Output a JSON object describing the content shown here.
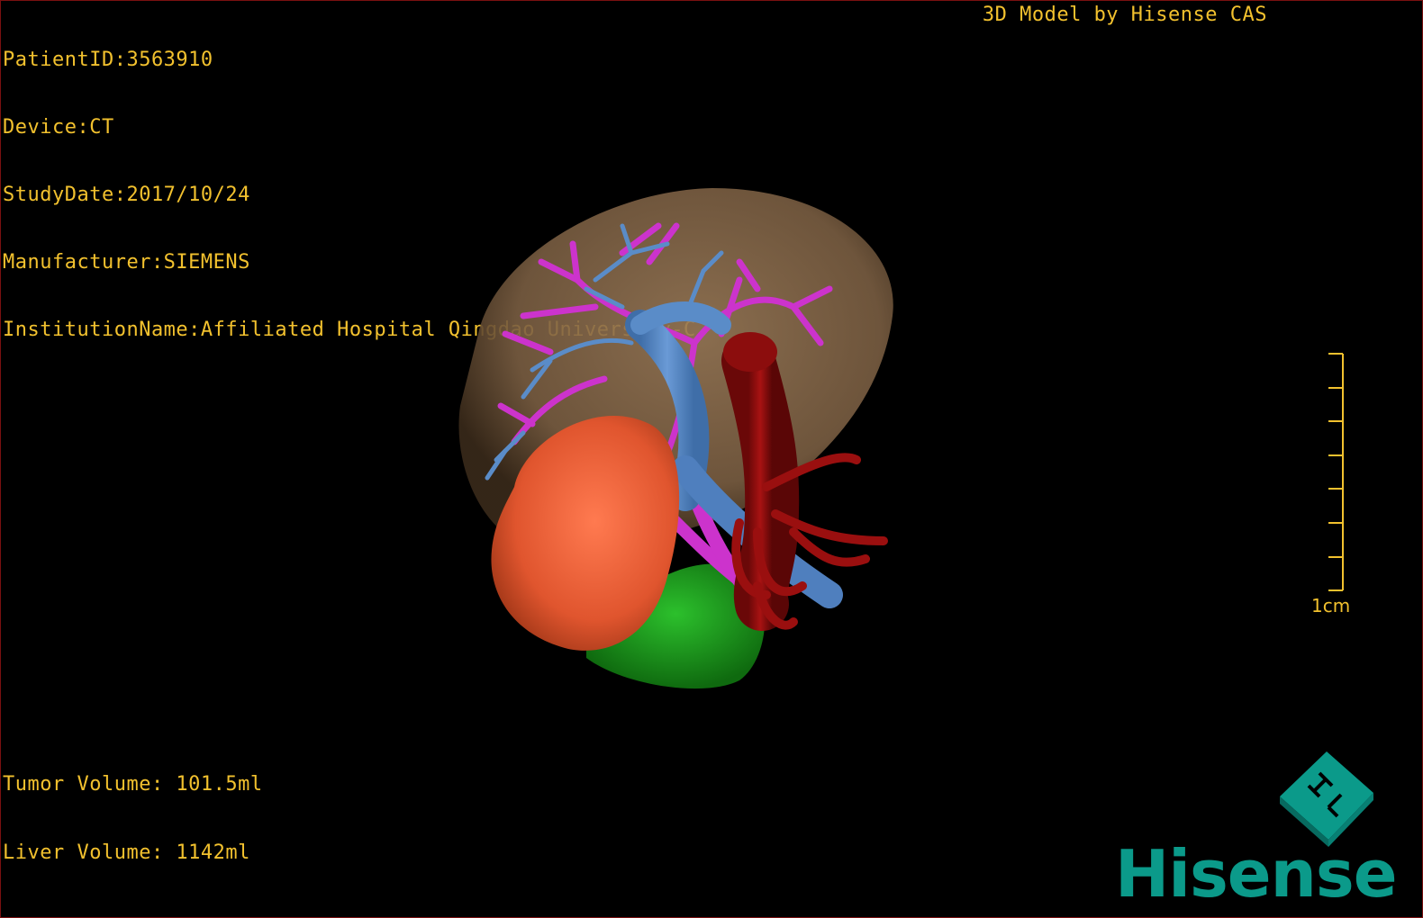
{
  "info": {
    "patient_id": "PatientID:3563910",
    "device": "Device:CT",
    "study_date": "StudyDate:2017/10/24",
    "manufacturer": "Manufacturer:SIEMENS",
    "institution": "InstitutionName:Affiliated Hospital Qingdao University-C"
  },
  "brand_caption": "3D Model by Hisense CAS",
  "volumes": {
    "tumor": "Tumor Volume: 101.5ml",
    "liver": "Liver Volume: 1142ml"
  },
  "scale": {
    "label": "1cm"
  },
  "logo": {
    "word": "Hisense",
    "icon": "hisense-cube-logo-icon"
  },
  "colors": {
    "overlay_text": "#f2c12e",
    "liver": "#8a6a4a",
    "tumor": "#e8603a",
    "portal_vein": "#5a8cc8",
    "hepatic_artery": "#8c0d0d",
    "biliary": "#cc33cc",
    "gallbladder": "#1f9a1f",
    "brand": "#0b9a8a"
  }
}
